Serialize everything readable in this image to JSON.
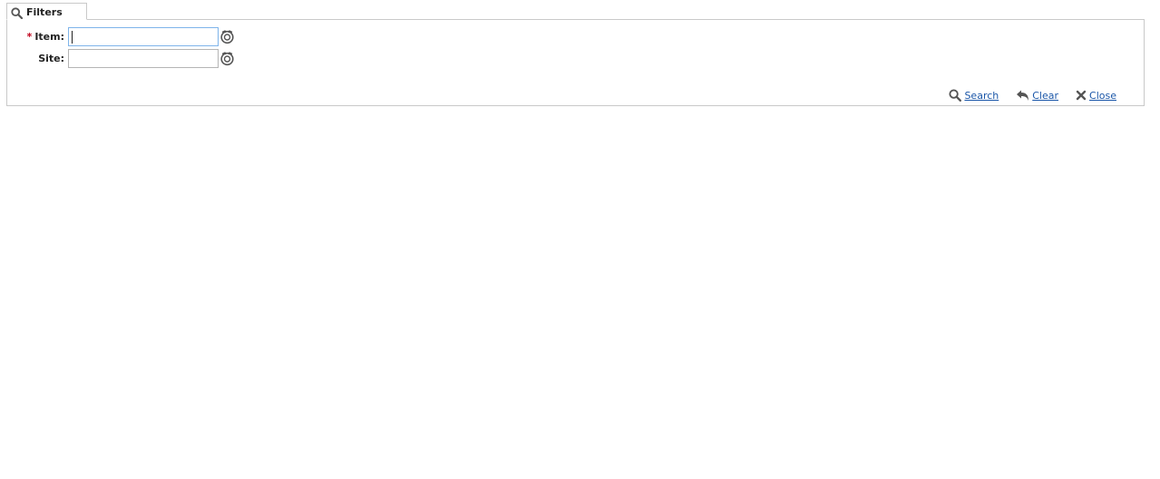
{
  "tab": {
    "label": "Filters",
    "icon": "search-icon"
  },
  "fields": {
    "item": {
      "required_marker": "*",
      "label": "Item:",
      "value": "",
      "lookup_icon": "lookup-icon"
    },
    "site": {
      "label": "Site:",
      "value": "",
      "lookup_icon": "lookup-icon"
    }
  },
  "actions": {
    "search_label": "Search",
    "clear_label": "Clear",
    "close_label": "Close"
  },
  "colors": {
    "required": "#c0001a",
    "link": "#1a56a8",
    "border": "#c9c9c9",
    "focus_border": "#7eb4ea",
    "icon": "#555555"
  }
}
